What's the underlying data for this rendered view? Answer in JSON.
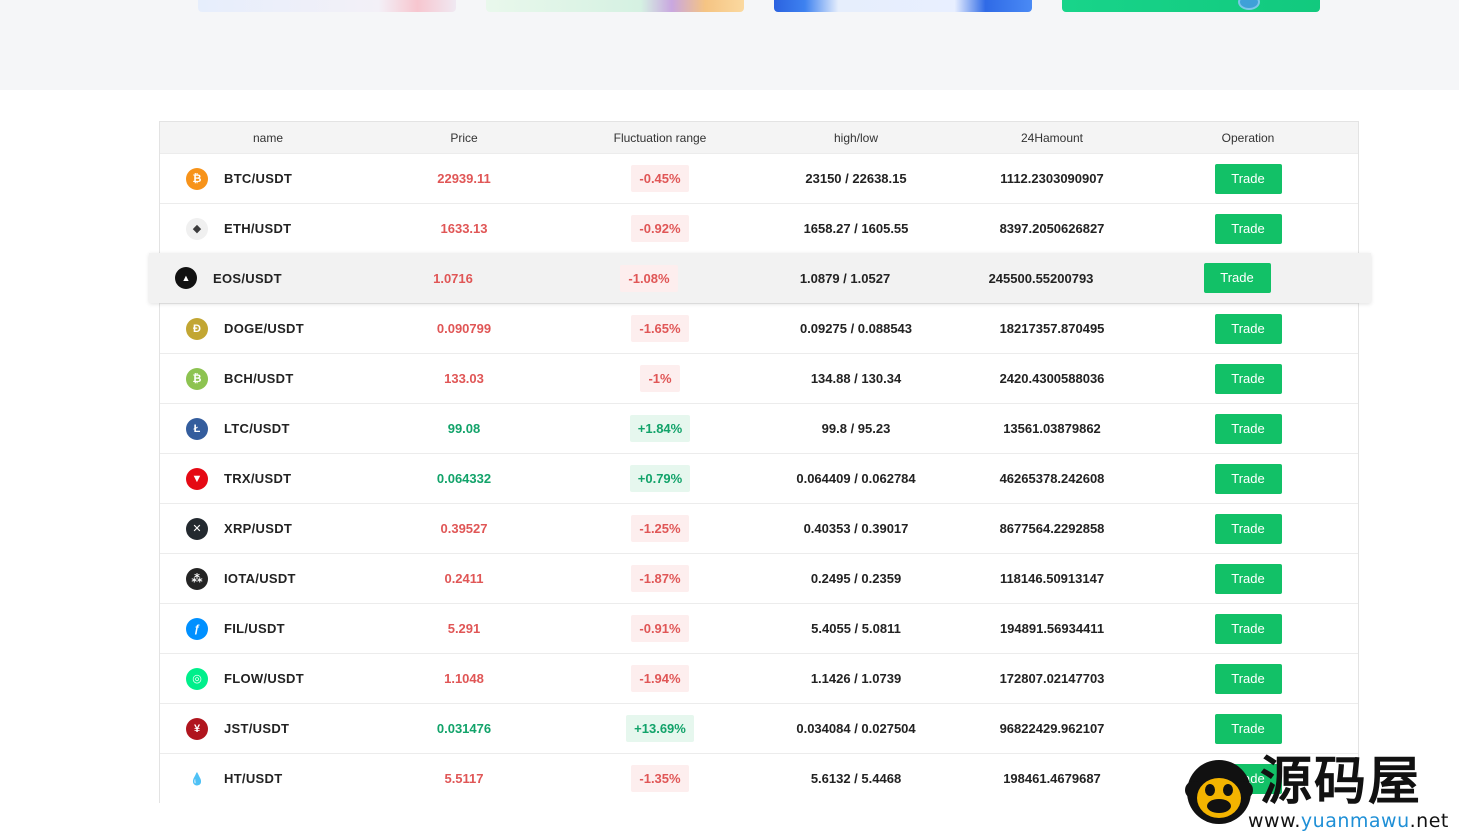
{
  "banners": [
    "banner-1",
    "banner-2",
    "banner-3",
    "banner-4"
  ],
  "table": {
    "headers": {
      "name": "name",
      "price": "Price",
      "fluctuation": "Fluctuation range",
      "highlow": "high/low",
      "amount": "24Hamount",
      "operation": "Operation"
    },
    "trade_label": "Trade",
    "rows": [
      {
        "pair": "BTC/USDT",
        "icon": "btc-icon",
        "icon_glyph": "₿",
        "icon_color": "#f7931a",
        "price": "22939.11",
        "change": "-0.45%",
        "dir": "down",
        "highlow": "23150 / 22638.15",
        "amount": "1112.2303090907"
      },
      {
        "pair": "ETH/USDT",
        "icon": "eth-icon",
        "icon_glyph": "◆",
        "icon_color": "#f0f0f0",
        "price": "1633.13",
        "change": "-0.92%",
        "dir": "down",
        "highlow": "1658.27 / 1605.55",
        "amount": "8397.2050626827"
      },
      {
        "pair": "EOS/USDT",
        "icon": "eos-icon",
        "icon_glyph": "▲",
        "icon_color": "#111111",
        "price": "1.0716",
        "change": "-1.08%",
        "dir": "down",
        "highlow": "1.0879 / 1.0527",
        "amount": "245500.55200793"
      },
      {
        "pair": "DOGE/USDT",
        "icon": "doge-icon",
        "icon_glyph": "Ð",
        "icon_color": "#c2a633",
        "price": "0.090799",
        "change": "-1.65%",
        "dir": "down",
        "highlow": "0.09275 / 0.088543",
        "amount": "18217357.870495"
      },
      {
        "pair": "BCH/USDT",
        "icon": "bch-icon",
        "icon_glyph": "₿",
        "icon_color": "#8dc351",
        "price": "133.03",
        "change": "-1%",
        "dir": "down",
        "highlow": "134.88 / 130.34",
        "amount": "2420.4300588036"
      },
      {
        "pair": "LTC/USDT",
        "icon": "ltc-icon",
        "icon_glyph": "Ł",
        "icon_color": "#345d9d",
        "price": "99.08",
        "change": "+1.84%",
        "dir": "up",
        "highlow": "99.8 / 95.23",
        "amount": "13561.03879862"
      },
      {
        "pair": "TRX/USDT",
        "icon": "trx-icon",
        "icon_glyph": "▼",
        "icon_color": "#e50914",
        "price": "0.064332",
        "change": "+0.79%",
        "dir": "up",
        "highlow": "0.064409 / 0.062784",
        "amount": "46265378.242608"
      },
      {
        "pair": "XRP/USDT",
        "icon": "xrp-icon",
        "icon_glyph": "✕",
        "icon_color": "#23292f",
        "price": "0.39527",
        "change": "-1.25%",
        "dir": "down",
        "highlow": "0.40353 / 0.39017",
        "amount": "8677564.2292858"
      },
      {
        "pair": "IOTA/USDT",
        "icon": "iota-icon",
        "icon_glyph": "⁂",
        "icon_color": "#242424",
        "price": "0.2411",
        "change": "-1.87%",
        "dir": "down",
        "highlow": "0.2495 / 0.2359",
        "amount": "118146.50913147"
      },
      {
        "pair": "FIL/USDT",
        "icon": "fil-icon",
        "icon_glyph": "ƒ",
        "icon_color": "#0090ff",
        "price": "5.291",
        "change": "-0.91%",
        "dir": "down",
        "highlow": "5.4055 / 5.0811",
        "amount": "194891.56934411"
      },
      {
        "pair": "FLOW/USDT",
        "icon": "flow-icon",
        "icon_glyph": "◎",
        "icon_color": "#00ef8b",
        "price": "1.1048",
        "change": "-1.94%",
        "dir": "down",
        "highlow": "1.1426 / 1.0739",
        "amount": "172807.02147703"
      },
      {
        "pair": "JST/USDT",
        "icon": "jst-icon",
        "icon_glyph": "¥",
        "icon_color": "#b0151e",
        "price": "0.031476",
        "change": "+13.69%",
        "dir": "up",
        "highlow": "0.034084 / 0.027504",
        "amount": "96822429.962107"
      },
      {
        "pair": "HT/USDT",
        "icon": "ht-icon",
        "icon_glyph": "💧",
        "icon_color": "#ffffff",
        "price": "5.5117",
        "change": "-1.35%",
        "dir": "down",
        "highlow": "5.6132 / 5.4468",
        "amount": "198461.4679687"
      }
    ]
  },
  "watermark": {
    "title": "源码屋",
    "url_prefix": "www.",
    "url_accent": "yuanmawu",
    "url_suffix": ".net"
  },
  "colors": {
    "up": "#12a36a",
    "down": "#e05656",
    "trade_button": "#12c167"
  }
}
